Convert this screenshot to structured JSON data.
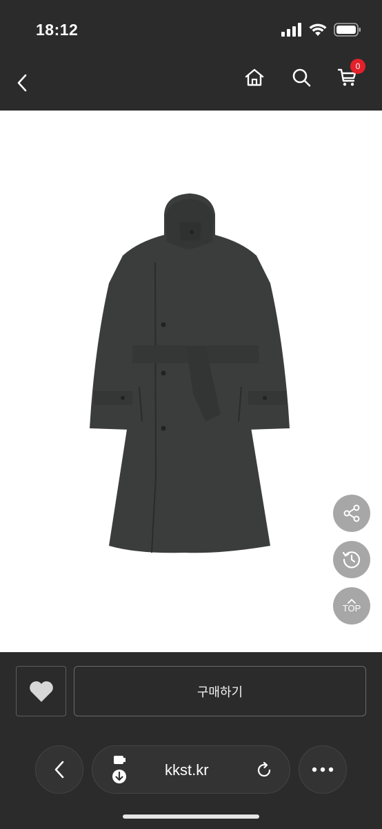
{
  "status_bar": {
    "time": "18:12"
  },
  "nav": {
    "cart_count": "0"
  },
  "product": {
    "image_icon": "coat-image"
  },
  "floating": {
    "top_label": "TOP"
  },
  "purchase": {
    "buy_label": "구매하기"
  },
  "browser": {
    "url": "kkst.kr"
  },
  "colors": {
    "badge": "#e4202a",
    "fab": "#a7a7a7",
    "background": "#2b2b2b"
  }
}
